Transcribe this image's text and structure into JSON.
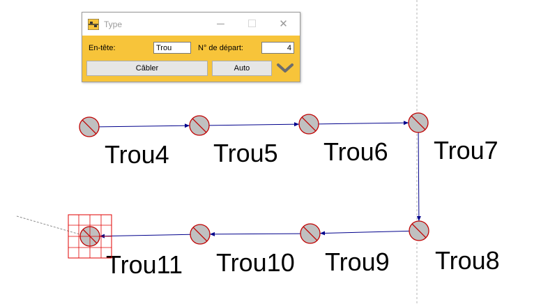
{
  "dialog": {
    "title": "Type",
    "header_label": "En-tête:",
    "header_value": "Trou",
    "start_label": "N° de départ:",
    "start_value": "4",
    "cable_button": "Câbler",
    "auto_button": "Auto",
    "minimize_glyph": "─",
    "maximize_glyph": "☐",
    "close_glyph": "✕"
  },
  "holes": [
    {
      "label": "Trou4"
    },
    {
      "label": "Trou5"
    },
    {
      "label": "Trou6"
    },
    {
      "label": "Trou7"
    },
    {
      "label": "Trou8"
    },
    {
      "label": "Trou9"
    },
    {
      "label": "Trou10"
    },
    {
      "label": "Trou11"
    }
  ],
  "colors": {
    "dialog_bg": "#f7c43a",
    "hole_fill": "#c0c0c0",
    "hole_stroke": "#c00000",
    "connector": "#00008b",
    "selection": "#e00000"
  }
}
